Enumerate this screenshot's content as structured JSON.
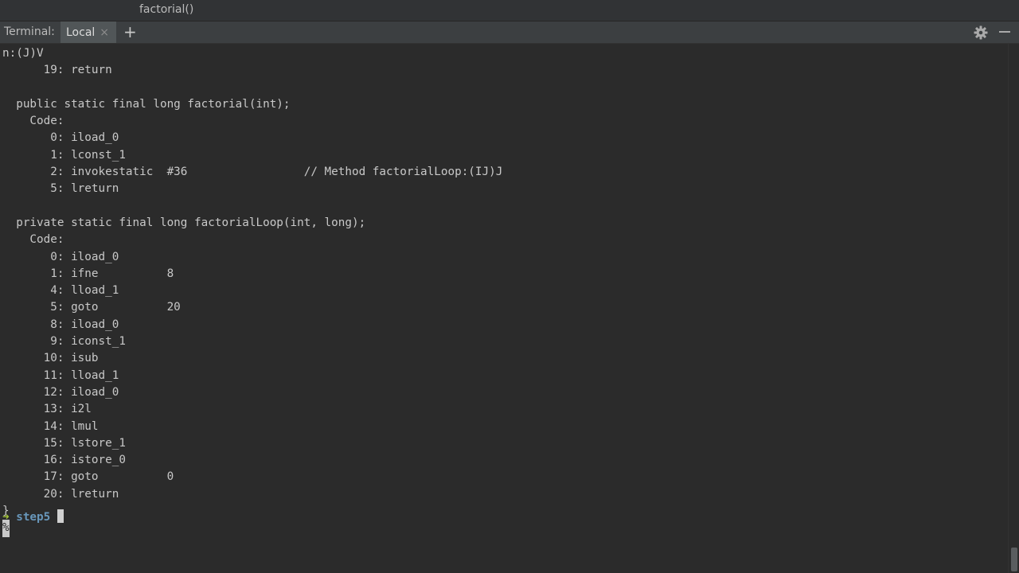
{
  "window": {
    "title": "factorial()"
  },
  "toolwindow": {
    "label": "Terminal:",
    "tab_label": "Local",
    "close_glyph": "×",
    "add_glyph": "+",
    "settings_icon": "gear-icon",
    "minimize_icon": "minimize-icon"
  },
  "terminal": {
    "output": "n:(J)V\n      19: return\n\n  public static final long factorial(int);\n    Code:\n       0: iload_0\n       1: lconst_1\n       2: invokestatic  #36                 // Method factorialLoop:(IJ)J\n       5: lreturn\n\n  private static final long factorialLoop(int, long);\n    Code:\n       0: iload_0\n       1: ifne          8\n       4: lload_1\n       5: goto          20\n       8: iload_0\n       9: iconst_1\n      10: isub\n      11: lload_1\n      12: iload_0\n      13: i2l\n      14: lmul\n      15: lstore_1\n      16: istore_0\n      17: goto          0\n      20: lreturn\n}",
    "percent_marker": "%",
    "prompt_arrow": "➜",
    "prompt_dir": "step5"
  },
  "colors": {
    "background": "#2b2b2b",
    "text": "#c8c8c8",
    "prompt_arrow": "#a4c639",
    "prompt_dir": "#6897bb"
  }
}
